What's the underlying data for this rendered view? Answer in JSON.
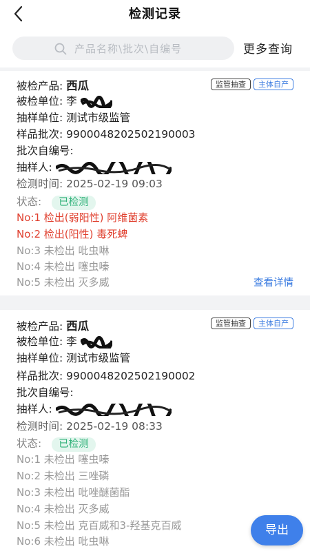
{
  "header": {
    "title": "检测记录"
  },
  "search": {
    "placeholder": "产品名称\\批次\\自编号",
    "more_label": "更多查询"
  },
  "labels": {
    "product": "被检产品:",
    "inspected_unit": "被检单位:",
    "sampling_unit": "抽样单位:",
    "batch": "样品批次:",
    "self_no": "批次自编号:",
    "sampler": "抽样人:",
    "test_time": "检测时间:",
    "status": "状态:"
  },
  "records": [
    {
      "product": "西瓜",
      "tags": [
        "监管抽查",
        "主体自产"
      ],
      "inspected_unit": "李",
      "sampling_unit": "测试市级监管",
      "batch": "990004820250219000 3",
      "batch_clean": "9900048202502190003",
      "self_no": "",
      "test_time": "2025-02-19 09:03",
      "status": "已检测",
      "items": [
        {
          "text": "No:1 检出(弱阳性) 阿维菌素",
          "result": "positive"
        },
        {
          "text": "No:2 检出(阳性) 毒死蜱",
          "result": "positive"
        },
        {
          "text": "No:3 未检出 吡虫啉",
          "result": "negative"
        },
        {
          "text": "No:4 未检出 噻虫嗪",
          "result": "negative"
        },
        {
          "text": "No:5 未检出 灭多威",
          "result": "negative"
        }
      ],
      "detail_label": "查看详情"
    },
    {
      "product": "西瓜",
      "tags": [
        "监管抽查",
        "主体自产"
      ],
      "inspected_unit": "李",
      "sampling_unit": "测试市级监管",
      "batch": "9900048202502190002",
      "self_no": "",
      "test_time": "2025-02-19 08:33",
      "status": "已检测",
      "items": [
        {
          "text": "No:1 未检出 噻虫嗪",
          "result": "negative"
        },
        {
          "text": "No:2 未检出 三唑磷",
          "result": "negative"
        },
        {
          "text": "No:3 未检出 吡唑醚菌酯",
          "result": "negative"
        },
        {
          "text": "No:4 未检出 灭多威",
          "result": "negative"
        },
        {
          "text": "No:5 未检出 克百威和3-羟基克百威",
          "result": "negative"
        },
        {
          "text": "No:6 未检出 吡虫啉",
          "result": "negative"
        }
      ]
    }
  ],
  "export_label": "导出",
  "colors": {
    "accent": "#3f80ea",
    "positive": "#e0402f",
    "status_green": "#31b27a"
  }
}
